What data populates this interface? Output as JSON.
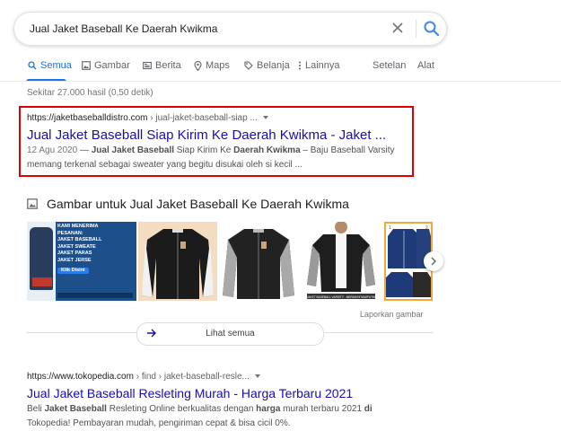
{
  "search": {
    "query": "Jual Jaket Baseball Ke Daerah Kwikma"
  },
  "tabs": {
    "items": [
      {
        "label": "Semua",
        "icon": "search-icon",
        "active": true
      },
      {
        "label": "Gambar",
        "icon": "image-icon"
      },
      {
        "label": "Berita",
        "icon": "news-icon"
      },
      {
        "label": "Maps",
        "icon": "map-pin-icon"
      },
      {
        "label": "Belanja",
        "icon": "tag-icon"
      },
      {
        "label": "Lainnya",
        "icon": "more-icon"
      }
    ],
    "settings": "Setelan",
    "tools": "Alat"
  },
  "stats": "Sekitar 27.000 hasil (0,50 detik)",
  "result1": {
    "domain": "https://jaketbaseballdistro.com",
    "path": " › jual-jaket-baseball-siap ...",
    "title": "Jual Jaket Baseball Siap Kirim Ke Daerah Kwikma - Jaket ...",
    "date": "12 Agu 2020",
    "snippet_parts": [
      " — ",
      "Jual Jaket Baseball",
      " Siap Kirim Ke ",
      "Daerah Kwikma",
      " – Baju Baseball Varsity memang terkenal sebagai sweater yang begitu disukai oleh si kecil ..."
    ]
  },
  "images": {
    "heading": "Gambar untuk Jual Jaket Baseball Ke Daerah Kwikma",
    "report": "Laporkan gambar",
    "see_all": "Lihat semua",
    "thumb1_lines": [
      "KAMI MENERIMA",
      "PESANAN:",
      "JAKET BASEBALL",
      "JAKET SWEATE",
      "JAKET PARAS",
      "JAKET JERSE",
      "Klik Disini"
    ],
    "thumb5_label": "JAKET BASEBALL VARSITY - MERAH/HITAM/PUTIH"
  },
  "result2": {
    "domain": "https://www.tokopedia.com",
    "path": " › find › jaket-baseball-resle...",
    "title": "Jual Jaket Baseball Resleting Murah - Harga Terbaru 2021",
    "snippet_parts": [
      "Beli ",
      "Jaket Baseball",
      " Resleting Online berkualitas dengan ",
      "harga",
      " murah terbaru 2021 ",
      "di",
      " Tokopedia! Pembayaran mudah, pengiriman cepat & bisa cicil 0%."
    ]
  },
  "colors": {
    "link": "#1a0dab",
    "accent": "#1a73e8",
    "highlight_border": "#dd0000"
  }
}
